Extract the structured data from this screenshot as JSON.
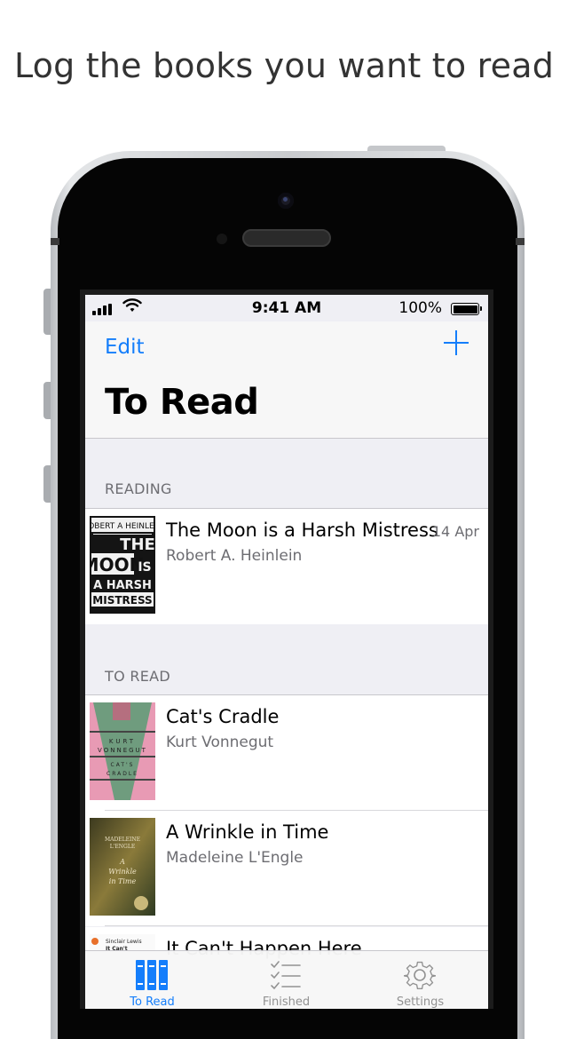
{
  "headline": "Log the books you want to read",
  "status_bar": {
    "time": "9:41 AM",
    "battery": "100%"
  },
  "nav": {
    "edit": "Edit",
    "title": "To Read",
    "add_icon": "plus-icon"
  },
  "sections": [
    {
      "header": "READING",
      "rows": [
        {
          "title": "The Moon is a Harsh Mistress",
          "author": "Robert A. Heinlein",
          "date": "14 Apr",
          "cover_text": [
            "ROBERT A HEINLEIN",
            "THE",
            "MOON",
            "IS",
            "A HARSH",
            "MISTRESS"
          ]
        }
      ]
    },
    {
      "header": "TO READ",
      "rows": [
        {
          "title": "Cat's Cradle",
          "author": "Kurt Vonnegut",
          "cover_text": [
            "KURT",
            "VONNEGUT",
            "CAT'S",
            "CRADLE"
          ]
        },
        {
          "title": "A Wrinkle in Time",
          "author": "Madeleine L'Engle",
          "cover_text": [
            "MADELEINE",
            "L'ENGLE",
            "A",
            "Wrinkle",
            "in Time"
          ]
        },
        {
          "title": "It Can't Happen Here",
          "author": "",
          "cover_text": [
            "Sinclair Lewis",
            "It Can't"
          ]
        }
      ]
    }
  ],
  "tabs": [
    {
      "label": "To Read",
      "icon": "books-icon",
      "active": true
    },
    {
      "label": "Finished",
      "icon": "checklist-icon",
      "active": false
    },
    {
      "label": "Settings",
      "icon": "gear-icon",
      "active": false
    }
  ],
  "colors": {
    "accent": "#147efb",
    "inactive": "#929292",
    "background": "#efeff4"
  }
}
